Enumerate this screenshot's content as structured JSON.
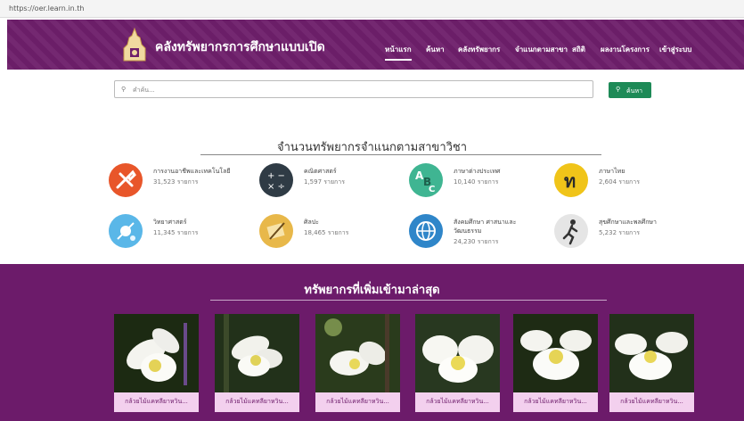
{
  "browser": {
    "url": "https://oer.learn.in.th"
  },
  "header": {
    "site_title": "คลังทรัพยากรการศึกษาแบบเปิด",
    "nav": [
      {
        "label": "หน้าแรก",
        "active": true
      },
      {
        "label": "ค้นหา",
        "active": false
      },
      {
        "label": "คลังทรัพยากร",
        "active": false
      },
      {
        "label": "จำแนกตามสาขา",
        "active": false
      },
      {
        "label": "สถิติ",
        "active": false
      },
      {
        "label": "ผลงานโครงการ",
        "active": false
      },
      {
        "label": "เข้าสู่ระบบ",
        "active": false
      }
    ]
  },
  "search": {
    "placeholder": "คำค้น...",
    "button_label": "ค้นหา"
  },
  "categories_section": {
    "title": "จำนวนทรัพยากรจำแนกตามสาขาวิชา",
    "items": [
      {
        "name": "การงานอาชีพและเทคโนโลยี",
        "count": "31,523 รายการ",
        "icon": "tools-icon",
        "color": "#e8562a"
      },
      {
        "name": "คณิตศาสตร์",
        "count": "1,597 รายการ",
        "icon": "math-icon",
        "color": "#2f3b45"
      },
      {
        "name": "ภาษาต่างประเทศ",
        "count": "10,140 รายการ",
        "icon": "abc-icon",
        "color": "#3fb592"
      },
      {
        "name": "ภาษาไทย",
        "count": "2,604 รายการ",
        "icon": "thai-letter-icon",
        "color": "#f0c419"
      },
      {
        "name": "วิทยาศาสตร์",
        "count": "11,345 รายการ",
        "icon": "science-icon",
        "color": "#5ab7e8"
      },
      {
        "name": "ศิลปะ",
        "count": "18,465 รายการ",
        "icon": "art-icon",
        "color": "#e8b84a"
      },
      {
        "name": "สังคมศึกษา ศาสนาและ",
        "name2": "วัฒนธรรม",
        "count": "24,230 รายการ",
        "icon": "globe-icon",
        "color": "#2f86c9"
      },
      {
        "name": "สุขศึกษาและพลศึกษา",
        "count": "5,232 รายการ",
        "icon": "running-icon",
        "color": "#e5e5e5"
      }
    ]
  },
  "latest_section": {
    "title": "ทรัพยากรที่เพิ่มเข้ามาล่าสุด",
    "items": [
      {
        "caption": "กล้วยไม้แคทลียาหวิน..."
      },
      {
        "caption": "กล้วยไม้แคทลียาหวิน..."
      },
      {
        "caption": "กล้วยไม้แคทลียาหวิน..."
      },
      {
        "caption": "กล้วยไม้แคทลียาหวิน..."
      },
      {
        "caption": "กล้วยไม้แคทลียาหวิน..."
      },
      {
        "caption": "กล้วยไม้แคทลียาหวิน..."
      }
    ]
  },
  "colors": {
    "brand": "#6e1f6b",
    "search_button": "#1e8a57",
    "caption_bg": "#f3d0ee"
  }
}
